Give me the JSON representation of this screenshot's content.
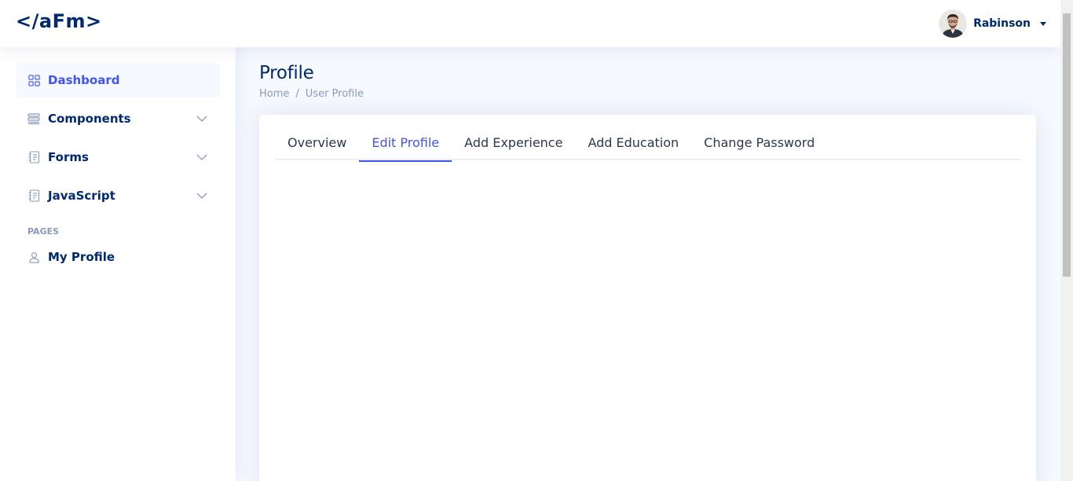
{
  "header": {
    "logo": "</aFm>",
    "user": {
      "name": "Rabinson",
      "avatar_icon": "user-avatar"
    }
  },
  "sidebar": {
    "items": [
      {
        "label": "Dashboard",
        "icon": "grid-icon",
        "active": true
      },
      {
        "label": "Components",
        "icon": "menu-icon",
        "expandable": true
      },
      {
        "label": "Forms",
        "icon": "journal-text-icon",
        "expandable": true
      },
      {
        "label": "JavaScript",
        "icon": "journal-text-icon",
        "expandable": true
      }
    ],
    "heading": "PAGES",
    "pages": [
      {
        "label": "My Profile",
        "icon": "person-icon"
      }
    ]
  },
  "main": {
    "title": "Profile",
    "breadcrumb": [
      "Home",
      "User Profile"
    ],
    "breadcrumb_separator": "/",
    "tabs": [
      {
        "label": "Overview"
      },
      {
        "label": "Edit Profile",
        "active": true
      },
      {
        "label": "Add Experience"
      },
      {
        "label": "Add Education"
      },
      {
        "label": "Change Password"
      }
    ]
  },
  "colors": {
    "brand": "#012970",
    "accent": "#4154f1",
    "muted": "#899bbd",
    "background": "#f6f9ff"
  }
}
